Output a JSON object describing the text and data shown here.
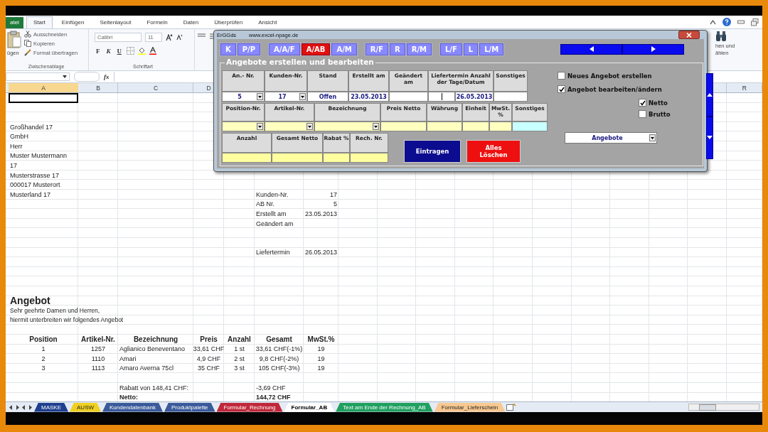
{
  "ribbon": {
    "tabs": [
      {
        "label": "atei",
        "kind": "file",
        "selected": false
      },
      {
        "label": "Start",
        "kind": "tab",
        "selected": true
      },
      {
        "label": "Einfügen",
        "kind": "tab",
        "selected": false
      },
      {
        "label": "Seitenlayout",
        "kind": "tab",
        "selected": false
      },
      {
        "label": "Formeln",
        "kind": "tab",
        "selected": false
      },
      {
        "label": "Daten",
        "kind": "tab",
        "selected": false
      },
      {
        "label": "Überprüfen",
        "kind": "tab",
        "selected": false
      },
      {
        "label": "Ansicht",
        "kind": "tab",
        "selected": false
      }
    ],
    "clipboard": {
      "paste_label": "ügen",
      "items": [
        "Ausschneiden",
        "Kopieren",
        "Format übertragen"
      ],
      "group_label": "Zwischenablage"
    },
    "font": {
      "name": "Calibri",
      "size": "11",
      "style_buttons": [
        "F",
        "K",
        "U"
      ],
      "group_label": "Schriftart"
    },
    "find": {
      "lines": [
        "hen und",
        "ählen"
      ]
    }
  },
  "formula_bar": {
    "fx": "fx"
  },
  "sheet": {
    "column_headers": [
      {
        "label": "A",
        "selected": true
      },
      {
        "label": "B",
        "selected": false
      },
      {
        "label": "C",
        "selected": false
      },
      {
        "label": "D",
        "selected": false
      }
    ],
    "last_column_header": "R",
    "address": [
      "Großhandel 17",
      "GmbH",
      "Herr",
      "Muster Mustermann",
      "17",
      "Musterstrasse 17",
      "000017 Musterort",
      "Musterland 17"
    ],
    "info": [
      {
        "label": "Kunden-Nr.",
        "value": "17"
      },
      {
        "label": "AB Nr.",
        "value": "5"
      },
      {
        "label": "Erstellt am",
        "value": "23.05.2013"
      },
      {
        "label": "Geändert am"
      },
      {
        "label": "Liefertermin",
        "value": "26.05.2013"
      }
    ],
    "title": "Angebot",
    "greeting": [
      "Sehr geehrte Damen und Herren,",
      "hiermit unterbreiten wir folgendes Angebot"
    ],
    "table": {
      "columns": [
        "Position",
        "Artikel-Nr.",
        "Bezeichnung",
        "Preis",
        "Anzahl",
        "Gesamt",
        "MwSt.%"
      ],
      "rows": [
        [
          "1",
          "1257",
          "Aglianico Beneventano",
          "33,61 CHF",
          "1 st",
          "33,61 CHF(-1%)",
          "19"
        ],
        [
          "2",
          "1110",
          "Amari",
          "4,9 CHF",
          "2 st",
          "9,8 CHF(-2%)",
          "19"
        ],
        [
          "3",
          "1113",
          "Amaro Averna 75cl",
          "35 CHF",
          "3 st",
          "105 CHF(-3%)",
          "19"
        ]
      ]
    },
    "summary": [
      {
        "label": "Rabatt von 148,41 CHF:",
        "value": "-3,69 CHF",
        "bold": false
      },
      {
        "label": "Netto:",
        "value": "144,72 CHF",
        "bold": true
      }
    ]
  },
  "sheet_tabs": [
    {
      "label": "MASKE",
      "color": "#1f3f8f",
      "selected": false
    },
    {
      "label": "AUSW",
      "color": "#f0d020",
      "selected": false
    },
    {
      "label": "Kundendatenbank",
      "color": "#3a5a9a",
      "selected": false
    },
    {
      "label": "Produktpalette",
      "color": "#3a5a9a",
      "selected": false
    },
    {
      "label": "Formular_Rechnung",
      "color": "#c0283a",
      "selected": false
    },
    {
      "label": "Formular_AB",
      "color": "#ffffff",
      "selected": true
    },
    {
      "label": "Text am Ende der Rechnung_AB",
      "color": "#20a060",
      "selected": false
    },
    {
      "label": "Formular_Lieferschein",
      "color": "#f8c890",
      "selected": false
    }
  ],
  "dialog": {
    "title": "ErGGds",
    "url": "www.excel-npage.de",
    "button_groups": [
      [
        {
          "label": "K",
          "selected": false
        },
        {
          "label": "P/P",
          "selected": false
        }
      ],
      [
        {
          "label": "A/A/F",
          "selected": false
        },
        {
          "label": "A/AB",
          "selected": true
        },
        {
          "label": "A/M",
          "selected": false
        }
      ],
      [
        {
          "label": "R/F",
          "selected": false
        },
        {
          "label": "R",
          "selected": false
        },
        {
          "label": "R/M",
          "selected": false
        }
      ],
      [
        {
          "label": "L/F",
          "selected": false
        },
        {
          "label": "L",
          "selected": false
        },
        {
          "label": "L/M",
          "selected": false
        }
      ]
    ],
    "frame_title": "Angebote erstellen und bearbeiten",
    "form_rows": [
      [
        {
          "label": "An.- Nr.",
          "kind": "dropdown",
          "value": "5",
          "color": "#ffffff"
        },
        {
          "label": "Kunden-Nr.",
          "kind": "dropdown",
          "value": "17",
          "color": "#ffffff"
        },
        {
          "label": "Stand",
          "kind": "text",
          "value": "Offen",
          "color": "#ffffff"
        },
        {
          "label": "Erstellt am",
          "kind": "text",
          "value": "23.05.2013",
          "color": "#ffffff"
        },
        {
          "label": "Geändert am",
          "kind": "text",
          "color": "#ffffff"
        },
        {
          "label": "Liefertermin Anzahl der Tage/Datum",
          "kind": "split",
          "value": "26.05.2013",
          "color": "#ffffff"
        },
        {
          "label": "Sonstiges",
          "kind": "text",
          "color": "#ffffff"
        }
      ],
      [
        {
          "label": "Position-Nr.",
          "kind": "dropdown",
          "color": "#ffffc0"
        },
        {
          "label": "Artikel-Nr.",
          "kind": "dropdown",
          "color": "#ffffc0"
        },
        {
          "label": "Bezeichnung",
          "kind": "dropdown",
          "color": "#ffffc0"
        },
        {
          "label": "Preis Netto",
          "kind": "text",
          "color": "#ffffc0"
        },
        {
          "label": "Währung",
          "kind": "text",
          "color": "#ffffc0"
        },
        {
          "label": "Einheit",
          "kind": "text",
          "color": "#ffffc0"
        },
        {
          "label": "MwSt. %",
          "kind": "text",
          "color": "#ffffc0"
        },
        {
          "label": "Sonstiges",
          "kind": "text",
          "color": "#c8ffff"
        }
      ],
      [
        {
          "label": "Anzahl",
          "kind": "text",
          "color": "#ffffa0"
        },
        {
          "label": "Gesamt Netto",
          "kind": "text",
          "color": "#ffffa0"
        },
        {
          "label": "Rabat %",
          "kind": "text",
          "color": "#ffffa0"
        },
        {
          "label": "Rech. Nr.",
          "kind": "text",
          "color": "#ffffa0"
        }
      ]
    ],
    "actions": [
      {
        "label": "Eintragen",
        "kind": "primary"
      },
      {
        "label": "Alles Löschen",
        "kind": "danger"
      }
    ],
    "options": [
      {
        "label": "Neues Angebot erstellen",
        "checked": false
      },
      {
        "label": "Angebot bearbeiten/ändern",
        "checked": true
      }
    ],
    "price_mode": [
      {
        "label": "Netto",
        "checked": true
      },
      {
        "label": "Brutto",
        "checked": false
      }
    ],
    "list_select": {
      "value": "Angebote"
    }
  }
}
